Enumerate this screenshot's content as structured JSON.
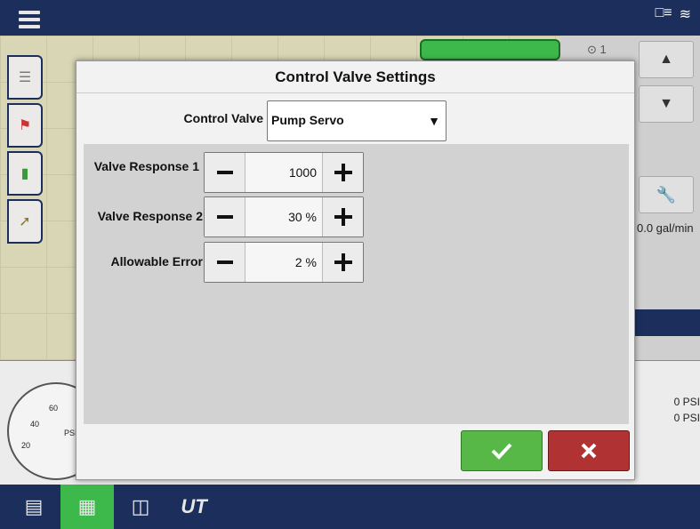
{
  "dialog": {
    "title": "Control Valve Settings",
    "control_valve_label": "Control Valve",
    "control_valve_value": "Pump Servo",
    "rows": [
      {
        "label": "Valve Response 1",
        "value": "1000"
      },
      {
        "label": "Valve Response 2",
        "value": "30 %"
      },
      {
        "label": "Allowable Error",
        "value": "2 %"
      }
    ]
  },
  "background": {
    "section_counter": "1",
    "rate_readout": "0.0 gal/min",
    "psi_1": "0 PSI",
    "psi_2": "0 PSI",
    "gauge_ticks": [
      "60",
      "40",
      "20"
    ],
    "gauge_unit": "PSI"
  },
  "bottom_nav": {
    "ut_label": "UT"
  },
  "colors": {
    "nav": "#1c2f5c",
    "ok": "#57b847",
    "cancel": "#b03232",
    "active_tab": "#3cb94a"
  }
}
